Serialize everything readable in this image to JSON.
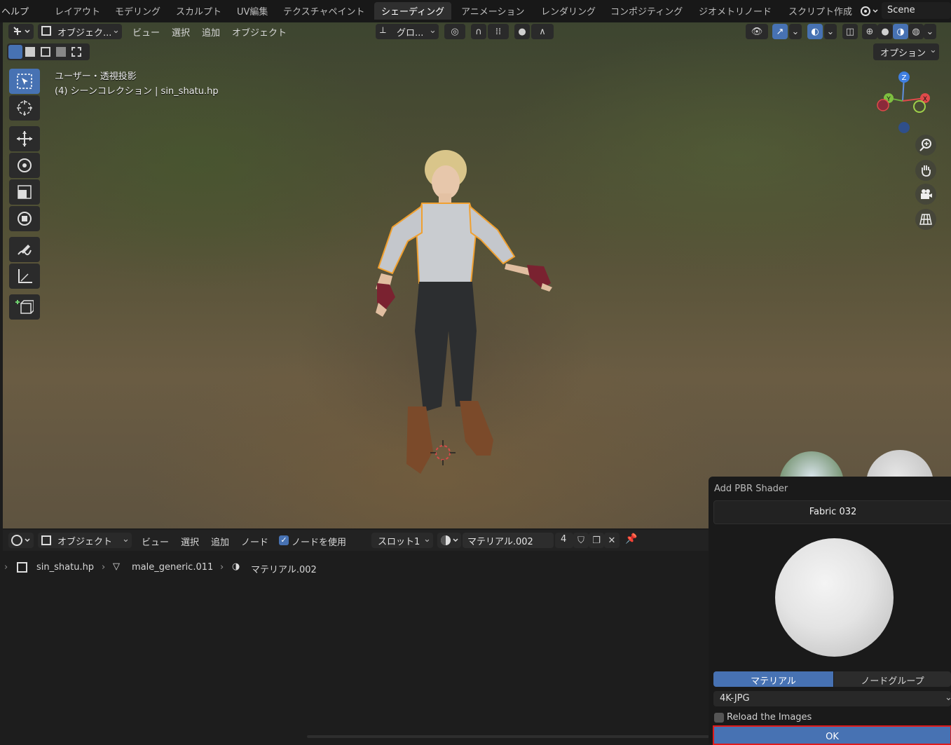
{
  "menubar": {
    "help": "ヘルプ",
    "workspace_tabs": [
      "レイアウト",
      "モデリング",
      "スカルプト",
      "UV編集",
      "テクスチャペイント",
      "シェーディング",
      "アニメーション",
      "レンダリング",
      "コンポジティング",
      "ジオメトリノード",
      "スクリプト作成"
    ],
    "active_tab": "シェーディング",
    "scene_name": "Scene"
  },
  "viewport_header": {
    "mode": "オブジェク...",
    "menus": [
      "ビュー",
      "選択",
      "追加",
      "オブジェクト"
    ],
    "orientation": "グロ...",
    "options": "オプション"
  },
  "viewport_info": {
    "line1": "ユーザー・透視投影",
    "line2": "(4) シーンコレクション | sin_shatu.hp"
  },
  "gizmo": {
    "z": "Z",
    "y": "Y",
    "x": "X"
  },
  "node_editor": {
    "mode": "オブジェクト",
    "menus": [
      "ビュー",
      "選択",
      "追加",
      "ノード"
    ],
    "use_nodes_label": "ノードを使用",
    "use_nodes_checked": true,
    "slot": "スロット1",
    "material_name": "マテリアル.002",
    "user_count": "4",
    "breadcrumb": [
      "sin_shatu.hp",
      "male_generic.011",
      "マテリアル.002"
    ]
  },
  "pbr_popup": {
    "title": "Add PBR Shader",
    "material": "Fabric 032",
    "tabs": [
      "マテリアル",
      "ノードグループ"
    ],
    "active_tab": "マテリアル",
    "resolution": "4K-JPG",
    "reload_label": "Reload the Images",
    "reload_checked": false,
    "ok_label": "OK"
  },
  "colors": {
    "accent": "#4772b3",
    "highlight_border": "#e01a1a",
    "selection_outline": "#f0a030"
  }
}
